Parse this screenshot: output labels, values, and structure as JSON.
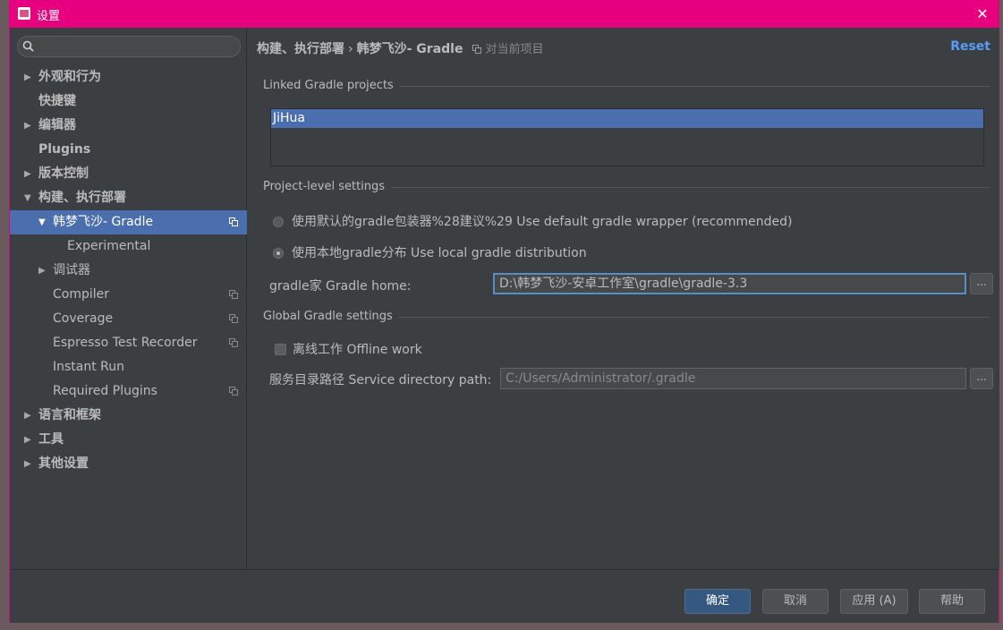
{
  "window": {
    "title": "设置",
    "close_glyph": "✕",
    "accent": "#e6007e"
  },
  "sidebar": {
    "search": {
      "value": "",
      "placeholder": ""
    },
    "items": [
      {
        "label": "外观和行为",
        "arrow": "▶",
        "bold": true,
        "level": 0
      },
      {
        "label": "快捷键",
        "arrow": "",
        "bold": true,
        "level": 0
      },
      {
        "label": "编辑器",
        "arrow": "▶",
        "bold": true,
        "level": 0
      },
      {
        "label": "Plugins",
        "arrow": "",
        "bold": true,
        "level": 0
      },
      {
        "label": "版本控制",
        "arrow": "▶",
        "bold": true,
        "level": 0
      },
      {
        "label": "构建、执行部署",
        "arrow": "▼",
        "bold": true,
        "level": 0
      },
      {
        "label": "韩梦飞沙- Gradle",
        "arrow": "▼",
        "bold": false,
        "level": 1,
        "selected": true,
        "copy_icon": true
      },
      {
        "label": "Experimental",
        "arrow": "",
        "bold": false,
        "level": 2
      },
      {
        "label": "调试器",
        "arrow": "▶",
        "bold": false,
        "level": 1
      },
      {
        "label": "Compiler",
        "arrow": "",
        "bold": false,
        "level": 1,
        "copy_icon": true
      },
      {
        "label": "Coverage",
        "arrow": "",
        "bold": false,
        "level": 1,
        "copy_icon": true
      },
      {
        "label": "Espresso Test Recorder",
        "arrow": "",
        "bold": false,
        "level": 1,
        "copy_icon": true
      },
      {
        "label": "Instant Run",
        "arrow": "",
        "bold": false,
        "level": 1
      },
      {
        "label": "Required Plugins",
        "arrow": "",
        "bold": false,
        "level": 1,
        "copy_icon": true
      },
      {
        "label": "语言和框架",
        "arrow": "▶",
        "bold": true,
        "level": 0
      },
      {
        "label": "工具",
        "arrow": "▶",
        "bold": true,
        "level": 0
      },
      {
        "label": "其他设置",
        "arrow": "▶",
        "bold": true,
        "level": 0
      }
    ]
  },
  "header": {
    "breadcrumb_parent": "构建、执行部署",
    "breadcrumb_sep": "›",
    "breadcrumb_current": "韩梦飞沙- Gradle",
    "scope_label": "对当前项目",
    "reset_label": "Reset",
    "link_color": "#589df6"
  },
  "linked_projects": {
    "title": "Linked Gradle projects",
    "items": [
      "JiHua"
    ]
  },
  "project_settings": {
    "title": "Project-level settings",
    "radio_default": "使用默认的gradle包装器%28建议%29 Use default gradle wrapper (recommended)",
    "radio_local": "使用本地gradle分布 Use local gradle distribution",
    "selected": "local",
    "gradle_home_label": "gradle家 Gradle home:",
    "gradle_home_value": "D:\\韩梦飞沙-安卓工作室\\gradle\\gradle-3.3",
    "browse_label": "..."
  },
  "global_settings": {
    "title": "Global Gradle settings",
    "offline_label": "离线工作 Offline work",
    "offline_checked": false,
    "service_dir_label": "服务目录路径 Service directory path:",
    "service_dir_value": "C:/Users/Administrator/.gradle",
    "browse_label": "..."
  },
  "footer": {
    "ok_label": "确定",
    "cancel_label": "取消",
    "apply_label": "应用 (A)",
    "help_label": "帮助"
  },
  "selection_color": "#4b6eaf"
}
